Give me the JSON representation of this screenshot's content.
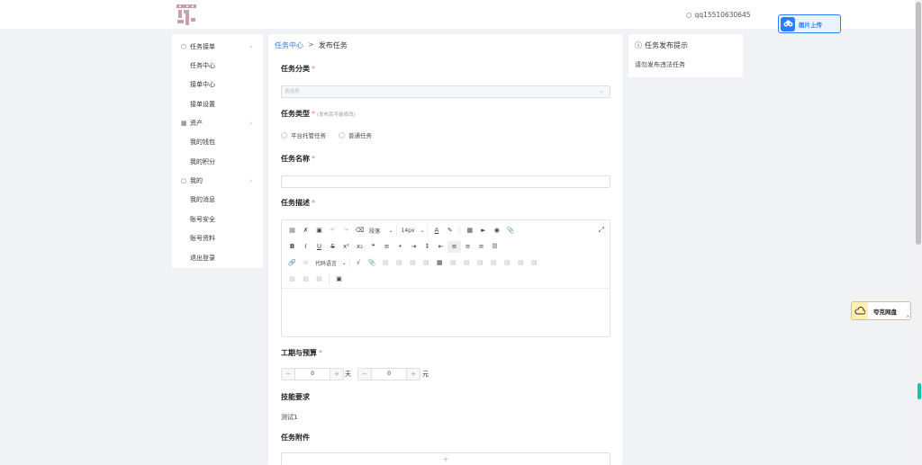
{
  "header": {
    "username": "qq15510630645",
    "upload_badge_label": "图片上传"
  },
  "sidebar": {
    "groups": [
      {
        "label": "任务接单",
        "items": [
          "任务中心",
          "接单中心",
          "接单设置"
        ]
      },
      {
        "label": "资产",
        "items": [
          "我的钱包",
          "我的积分"
        ]
      },
      {
        "label": "我的",
        "items": [
          "我的消息",
          "账号安全",
          "账号资料",
          "退出登录"
        ]
      }
    ]
  },
  "breadcrumb": {
    "parent": "任务中心",
    "separator": ">",
    "current": "发布任务"
  },
  "form": {
    "category": {
      "label": "任务分类",
      "required": "*",
      "placeholder": "请选择"
    },
    "type": {
      "label": "任务类型",
      "required": "*",
      "hint": "(发布后不能修改)",
      "options": [
        "平台托管任务",
        "普通任务"
      ]
    },
    "name": {
      "label": "任务名称",
      "required": "*"
    },
    "description": {
      "label": "任务描述",
      "required": "*",
      "toolbar": {
        "paragraph": "段落",
        "font_size": "14px",
        "code_language": "代码语言"
      }
    },
    "schedule_budget": {
      "label": "工期与预算",
      "required": "*",
      "days_value": "0",
      "days_unit": "天",
      "budget_value": "0",
      "budget_unit": "元"
    },
    "skills": {
      "label": "技能要求",
      "value": "测试1"
    },
    "attachments": {
      "label": "任务附件",
      "add": "+"
    }
  },
  "tips": {
    "title": "任务发布提示",
    "content": "请勿发布违法任务"
  },
  "netdisk": {
    "label": "夸克网盘"
  }
}
